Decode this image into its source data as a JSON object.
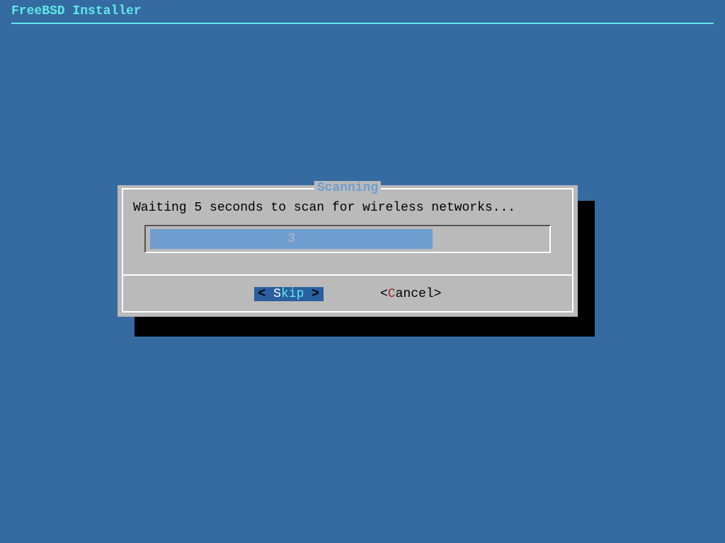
{
  "header": {
    "title": "FreeBSD Installer"
  },
  "dialog": {
    "title": "Scanning",
    "message": "Waiting 5 seconds to scan for wireless networks...",
    "progress_value": "3",
    "buttons": {
      "skip": {
        "open": "< ",
        "hotkey": "S",
        "rest": "kip",
        "close": " >"
      },
      "cancel": {
        "open": "<",
        "hotkey": "C",
        "rest": "ancel",
        "close": ">"
      }
    }
  }
}
